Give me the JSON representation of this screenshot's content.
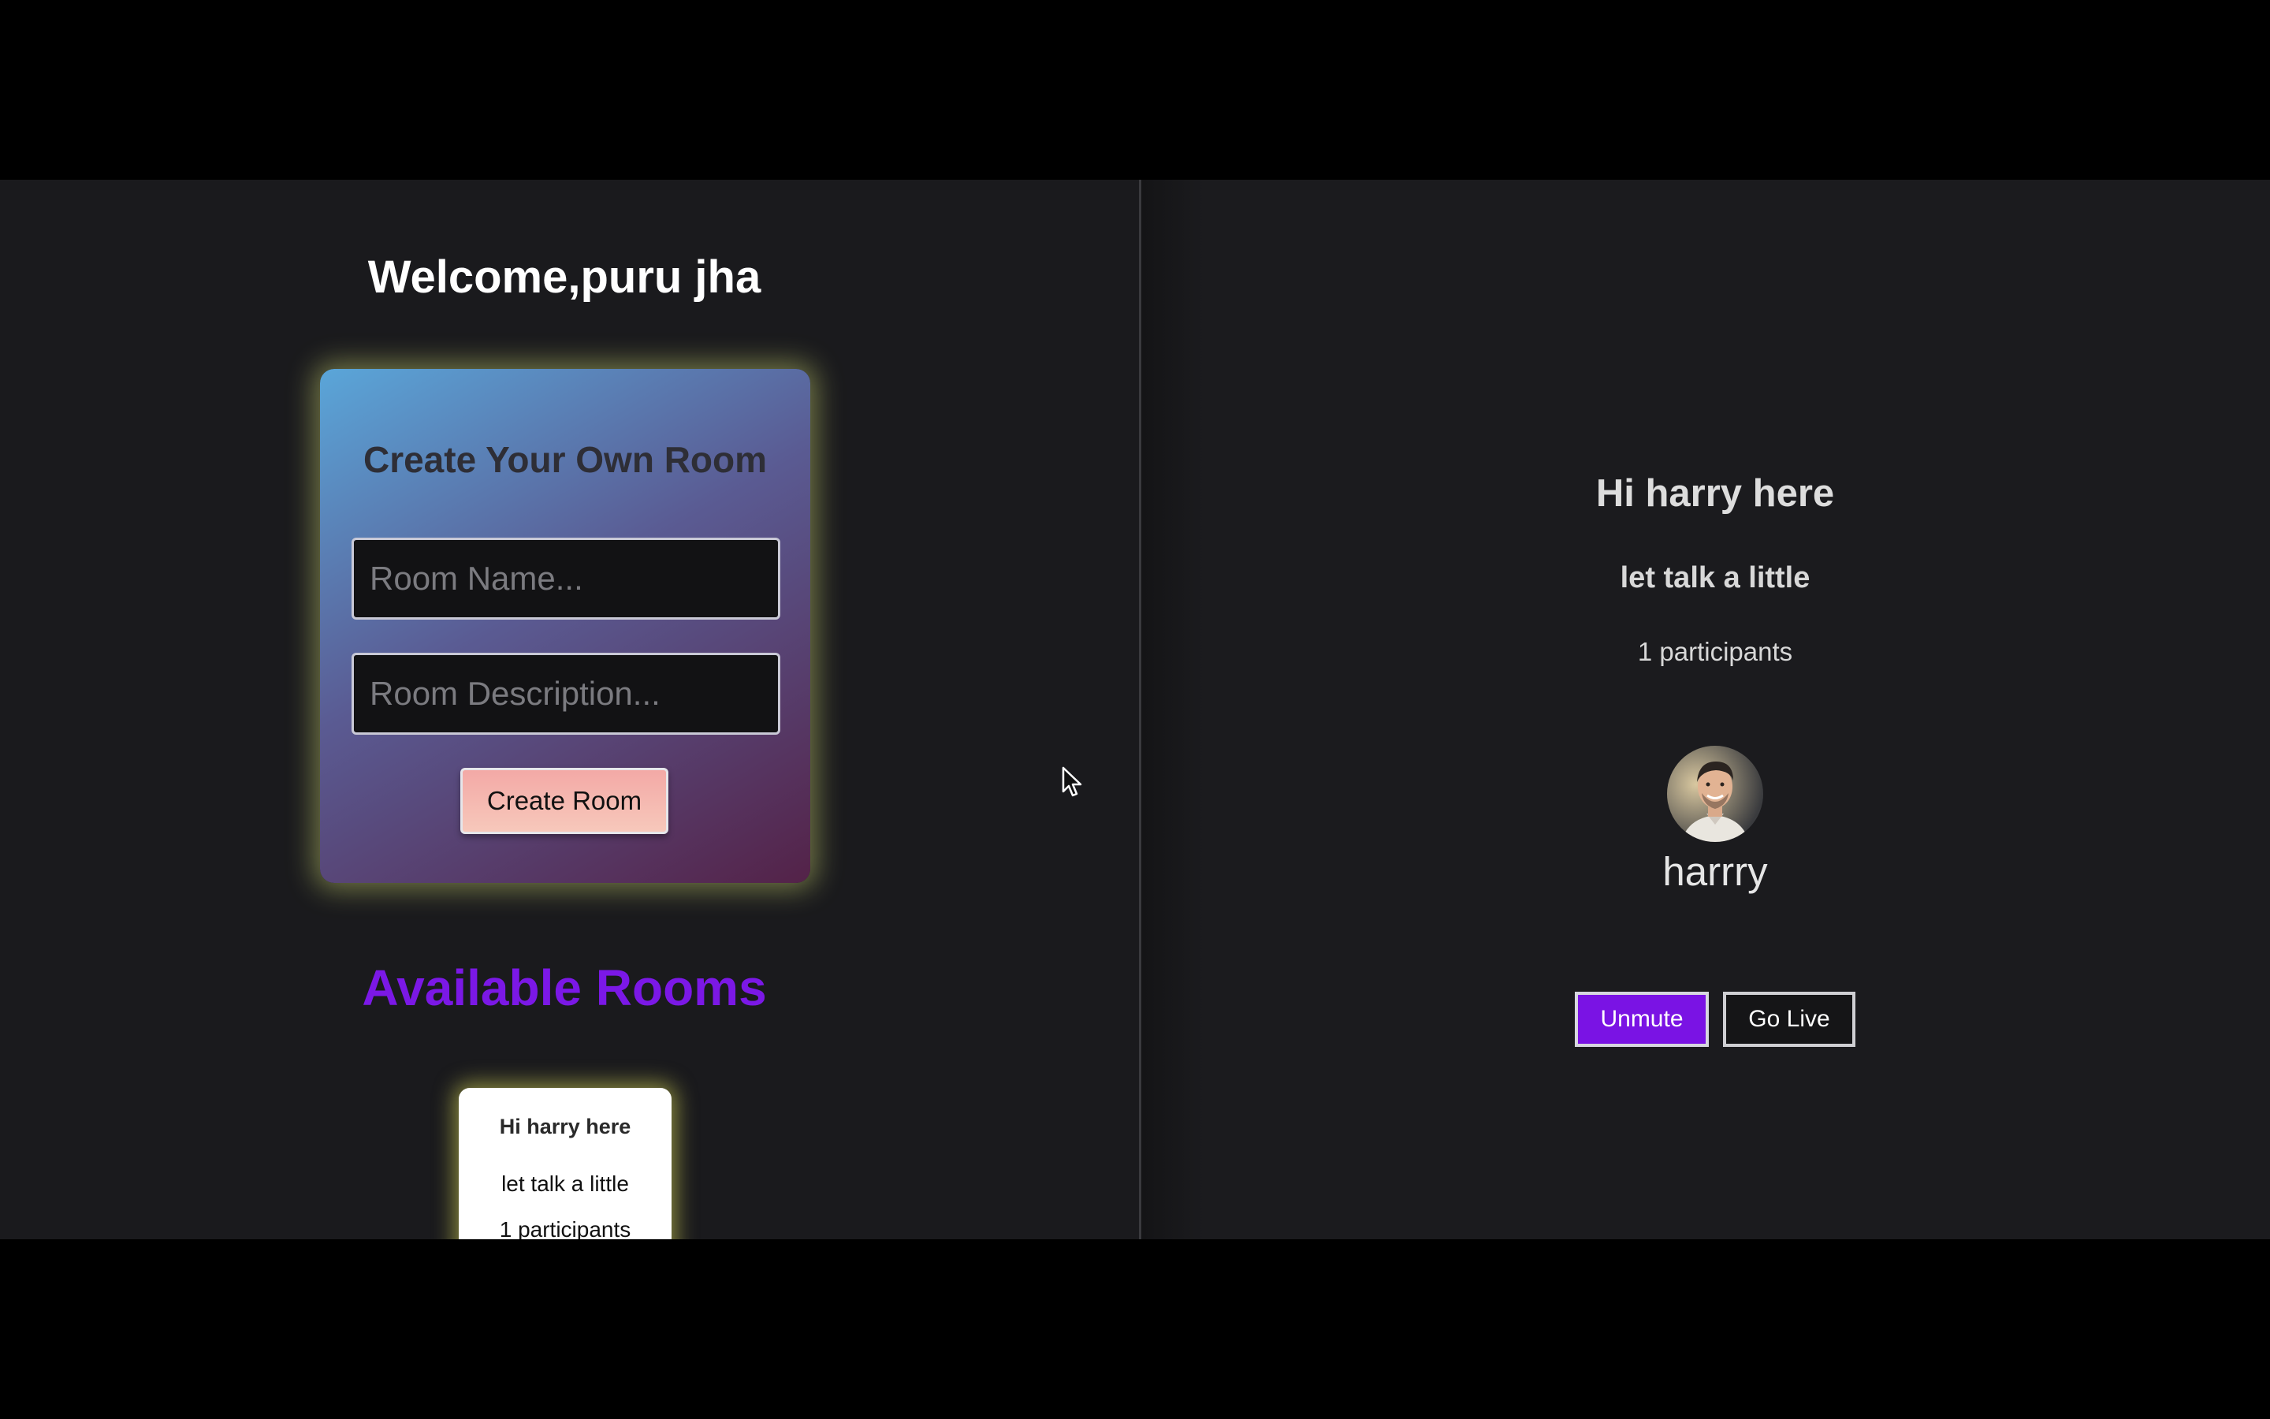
{
  "left": {
    "welcome": "Welcome,puru jha",
    "create_room": {
      "title": "Create Your Own Room",
      "name_placeholder": "Room Name...",
      "name_value": "",
      "description_placeholder": "Room Description...",
      "description_value": "",
      "button_label": "Create Room"
    },
    "available_title": "Available Rooms",
    "rooms": [
      {
        "title": "Hi harry here",
        "description": "let talk a little",
        "participants": "1 participants"
      }
    ]
  },
  "right": {
    "room_title": "Hi harry here",
    "room_description": "let talk a little",
    "participants": "1 participants",
    "speaker_name": "harrry",
    "unmute_label": "Unmute",
    "go_live_label": "Go Live"
  },
  "colors": {
    "accent_purple": "#7a13e4",
    "background": "#1b1b1e",
    "card_glow": "#e1e15a"
  }
}
